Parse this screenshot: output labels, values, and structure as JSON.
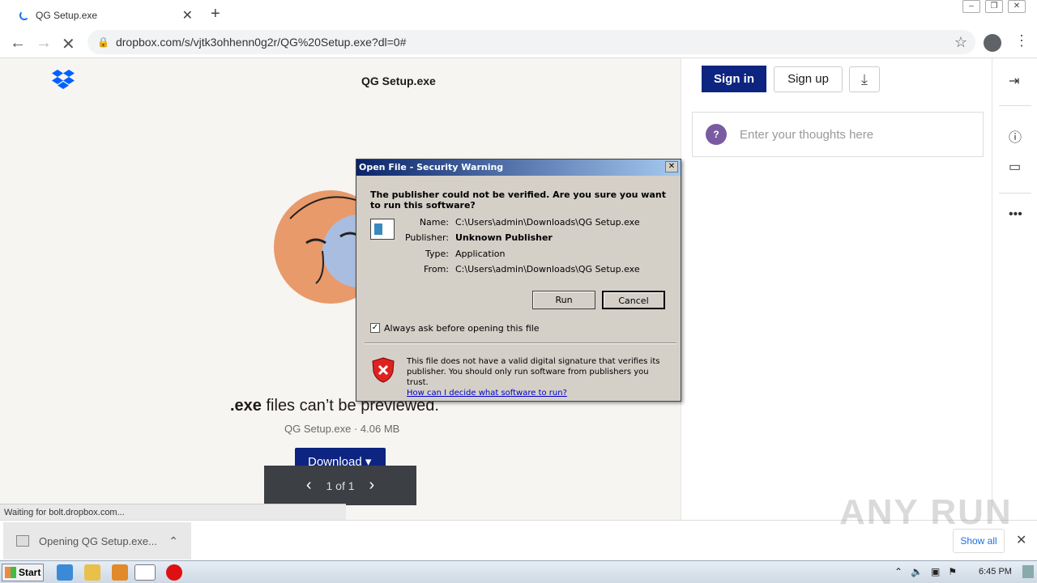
{
  "browser": {
    "tab_title": "QG Setup.exe",
    "url": "dropbox.com/s/vjtk3ohhenn0g2r/QG%20Setup.exe?dl=0#"
  },
  "page": {
    "file_title": "QG Setup.exe",
    "preview_bold": ".exe",
    "preview_rest": " files can’t be previewed.",
    "file_info": "QG Setup.exe · 4.06 MB",
    "download_label": "Download ▾",
    "pager_label": "1 of 1",
    "status_text": "Waiting for bolt.dropbox.com..."
  },
  "panel": {
    "signin": "Sign in",
    "signup": "Sign up",
    "comment_placeholder": "Enter your thoughts here",
    "qmark": "?"
  },
  "dialog": {
    "title": "Open File - Security Warning",
    "question": "The publisher could not be verified.  Are you sure you want to run this software?",
    "name_label": "Name:",
    "name_value": "C:\\Users\\admin\\Downloads\\QG Setup.exe",
    "publisher_label": "Publisher:",
    "publisher_value": "Unknown Publisher",
    "type_label": "Type:",
    "type_value": "Application",
    "from_label": "From:",
    "from_value": "C:\\Users\\admin\\Downloads\\QG Setup.exe",
    "run": "Run",
    "cancel": "Cancel",
    "checkbox_label": "Always ask before opening this file",
    "checkbox_checked": true,
    "warning_text": "This file does not have a valid digital signature that verifies its publisher.  You should only run software from publishers you trust.",
    "warning_link": "How can I decide what software to run?"
  },
  "shelf": {
    "item_label": "Opening QG Setup.exe...",
    "show_all": "Show all"
  },
  "watermark": "ANY RUN",
  "taskbar": {
    "start": "Start",
    "clock": "6:45 PM"
  },
  "colors": {
    "dropbox_blue": "#0d2481",
    "dialog_face": "#d4d0c8"
  }
}
